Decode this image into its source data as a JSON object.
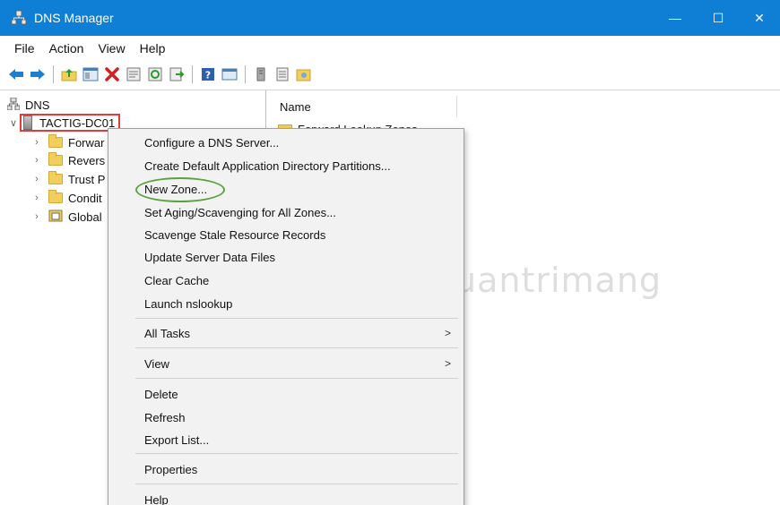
{
  "window": {
    "title": "DNS Manager",
    "controls": {
      "minimize": "—",
      "maximize": "☐",
      "close": "✕"
    }
  },
  "menubar": [
    "File",
    "Action",
    "View",
    "Help"
  ],
  "toolbar": {
    "icons": [
      "back-icon",
      "forward-icon",
      "up-folder-icon",
      "show-tree-icon",
      "delete-icon",
      "properties-icon",
      "refresh-icon",
      "export-icon",
      "help-icon",
      "console-icon",
      "server-icon",
      "list-icon",
      "zone-icon"
    ]
  },
  "tree": {
    "root": "DNS",
    "server": "TACTIG-DC01",
    "children": [
      "Forwar",
      "Revers",
      "Trust P",
      "Condit",
      "Global"
    ]
  },
  "list": {
    "column_name": "Name",
    "first_item_partial": "Forward Lookup Zones"
  },
  "context_menu": {
    "items": [
      "Configure a DNS Server...",
      "Create Default Application Directory Partitions...",
      "New Zone...",
      "Set Aging/Scavenging for All Zones...",
      "Scavenge Stale Resource Records",
      "Update Server Data Files",
      "Clear Cache",
      "Launch nslookup",
      "All Tasks",
      "View",
      "Delete",
      "Refresh",
      "Export List...",
      "Properties",
      "Help"
    ],
    "submenu_arrow": ">",
    "highlighted_item": "New Zone..."
  },
  "watermark": {
    "text": "uantrimang"
  },
  "colors": {
    "titlebar": "#0f7fd6",
    "server_outline": "#e23b3b",
    "new_zone_outline": "#5aa33c"
  }
}
